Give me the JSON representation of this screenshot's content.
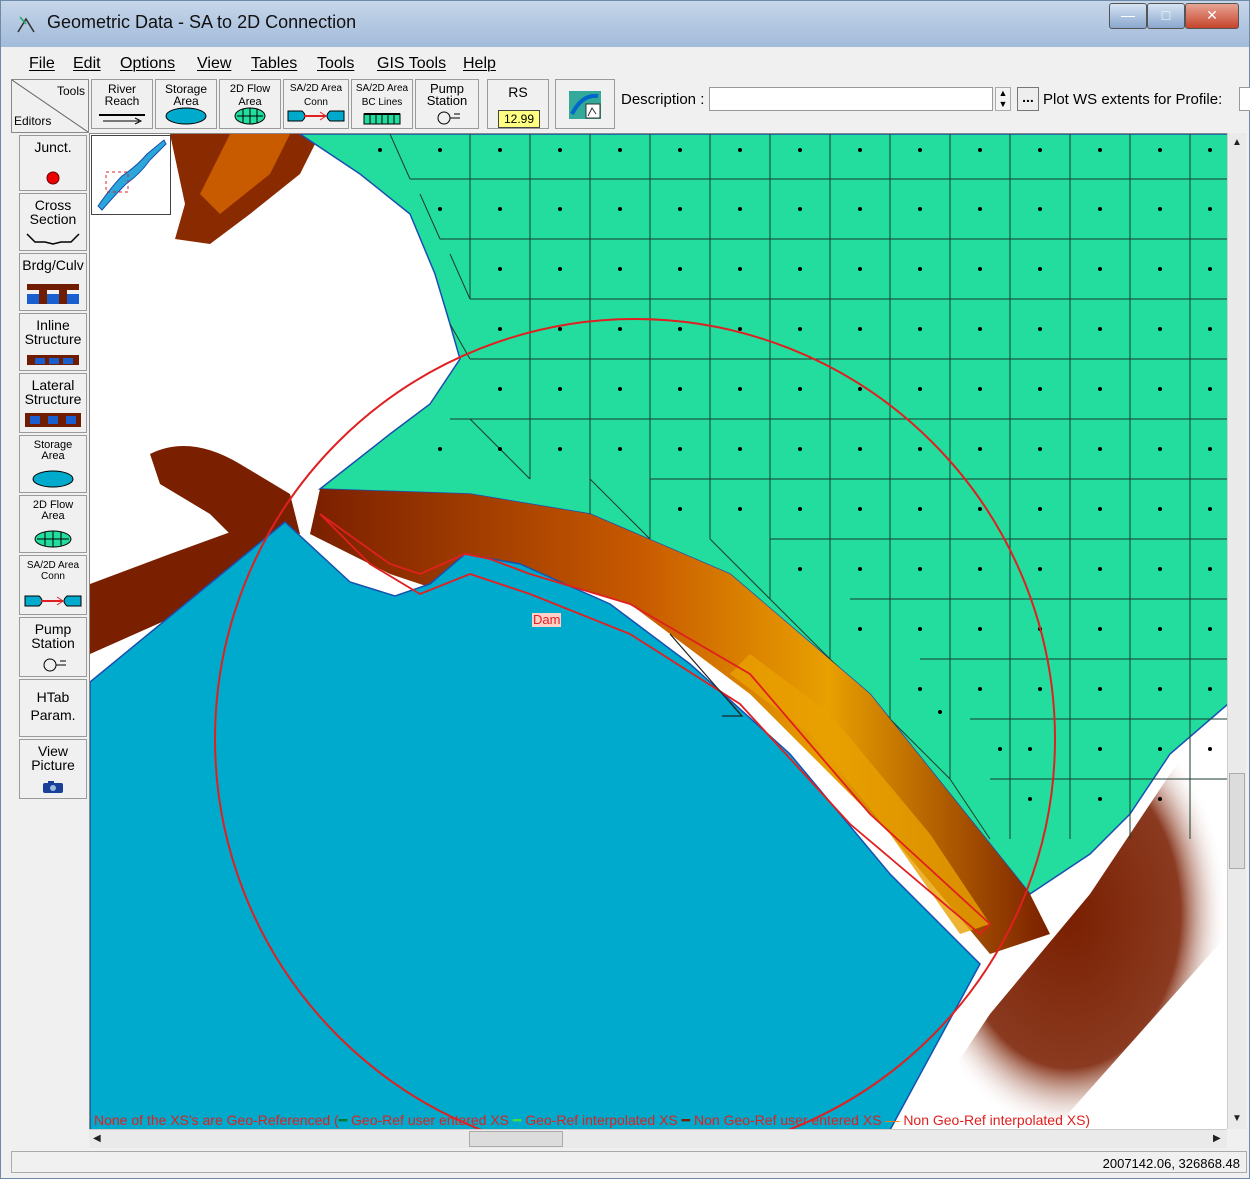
{
  "window": {
    "title": "Geometric Data - SA to 2D Connection",
    "controls": {
      "minimize": "—",
      "maximize": "□",
      "close": "✕"
    }
  },
  "menu": [
    "File",
    "Edit",
    "Options",
    "View",
    "Tables",
    "Tools",
    "GIS Tools",
    "Help"
  ],
  "toolbar": {
    "corner_tools": "Tools",
    "corner_editors": "Editors",
    "buttons": [
      {
        "line1": "River",
        "line2": "Reach"
      },
      {
        "line1": "Storage",
        "line2": "Area"
      },
      {
        "line1": "2D Flow",
        "line2": "Area"
      },
      {
        "line1": "SA/2D Area",
        "line2": "Conn"
      },
      {
        "line1": "SA/2D Area",
        "line2": "BC Lines"
      },
      {
        "line1": "Pump",
        "line2": "Station"
      },
      {
        "line1": "RS",
        "line2": "12.99"
      }
    ],
    "description_label": "Description :",
    "description_value": "",
    "ellipsis": "...",
    "plot_ws_label": "Plot WS extents for Profile:"
  },
  "sidebar": [
    {
      "line1": "Junct.",
      "line2": ""
    },
    {
      "line1": "Cross",
      "line2": "Section"
    },
    {
      "line1": "Brdg/Culv",
      "line2": ""
    },
    {
      "line1": "Inline",
      "line2": "Structure"
    },
    {
      "line1": "Lateral",
      "line2": "Structure"
    },
    {
      "line1": "Storage",
      "line2": "Area"
    },
    {
      "line1": "2D Flow",
      "line2": "Area"
    },
    {
      "line1": "SA/2D Area",
      "line2": "Conn"
    },
    {
      "line1": "Pump",
      "line2": "Station"
    },
    {
      "line1": "HTab",
      "line2": "Param."
    },
    {
      "line1": "View",
      "line2": "Picture"
    }
  ],
  "map": {
    "dam_label": "Dam",
    "legend": {
      "none_geo": "None of the XS's are Geo-Referenced (",
      "geo_user": "Geo-Ref user entered XS",
      "geo_interp": "Geo-Ref interpolated XS",
      "nongeo_user": "Non Geo-Ref user entered XS",
      "nongeo_interp": "Non Geo-Ref interpolated XS)"
    },
    "colors": {
      "storage_area": "#00aacc",
      "flow_area": "#22dd9e",
      "terrain_dark": "#7a1f00",
      "terrain_mid": "#c85a00",
      "terrain_light": "#e8a000",
      "connection": "#e02020"
    }
  },
  "status": {
    "coords": "2007142.06, 326868.48"
  }
}
